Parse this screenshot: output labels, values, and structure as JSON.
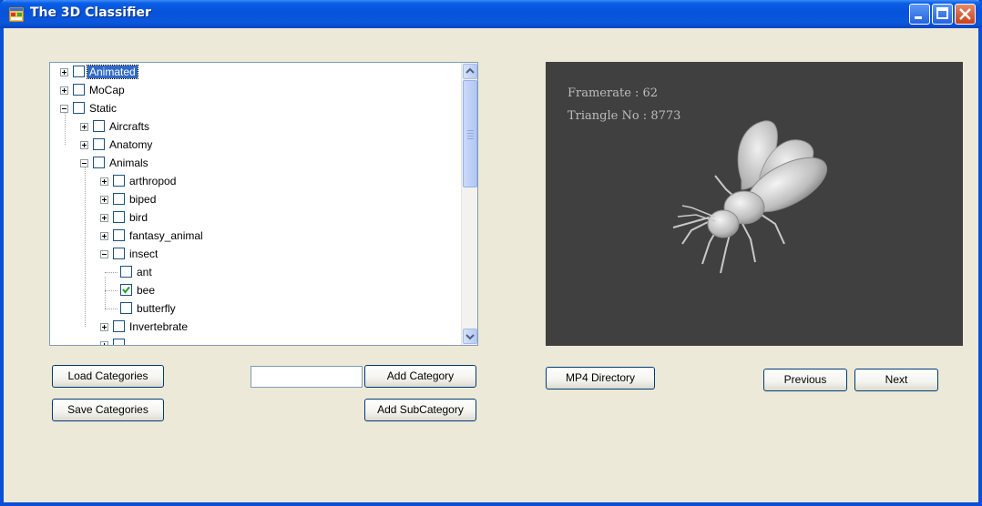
{
  "window": {
    "title": "The 3D Classifier"
  },
  "tree": {
    "nodes": [
      {
        "label": "Animated",
        "expander": "plus",
        "checked": false,
        "selected": true
      },
      {
        "label": "MoCap",
        "expander": "plus",
        "checked": false
      },
      {
        "label": "Static",
        "expander": "minus",
        "checked": false
      },
      {
        "label": "Aircrafts",
        "expander": "plus",
        "checked": false
      },
      {
        "label": "Anatomy",
        "expander": "plus",
        "checked": false
      },
      {
        "label": "Animals",
        "expander": "minus",
        "checked": false
      },
      {
        "label": "arthropod",
        "expander": "plus",
        "checked": false
      },
      {
        "label": "biped",
        "expander": "plus",
        "checked": false
      },
      {
        "label": "bird",
        "expander": "plus",
        "checked": false
      },
      {
        "label": "fantasy_animal",
        "expander": "plus",
        "checked": false
      },
      {
        "label": "insect",
        "expander": "minus",
        "checked": false
      },
      {
        "label": "ant",
        "expander": "none",
        "checked": false
      },
      {
        "label": "bee",
        "expander": "none",
        "checked": true
      },
      {
        "label": "butterfly",
        "expander": "none",
        "checked": false
      },
      {
        "label": "Invertebrate",
        "expander": "plus",
        "checked": false
      }
    ]
  },
  "viewer": {
    "framerate": "Framerate : 62",
    "triangles": "Triangle No : 8773"
  },
  "buttons": {
    "load_categories": "Load Categories",
    "save_categories": "Save Categories",
    "add_category": "Add Category",
    "add_subcategory": "Add SubCategory",
    "mp4_directory": "MP4 Directory",
    "previous": "Previous",
    "next": "Next"
  },
  "category_input": {
    "value": ""
  },
  "colors": {
    "titlebar": "#0a5ee6",
    "selection": "#316ac5",
    "viewer_bg": "#404040",
    "window_bg": "#ece9d8"
  }
}
